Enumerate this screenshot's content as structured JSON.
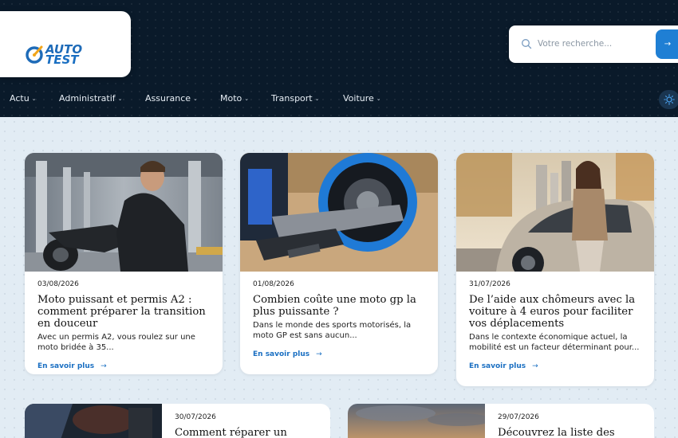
{
  "logo": {
    "line1": "AUTO",
    "line2": "TEST"
  },
  "search": {
    "placeholder": "Votre recherche...",
    "button_label": "→"
  },
  "nav": {
    "items": [
      {
        "label": "Actu"
      },
      {
        "label": "Administratif"
      },
      {
        "label": "Assurance"
      },
      {
        "label": "Moto"
      },
      {
        "label": "Transport"
      },
      {
        "label": "Voiture"
      }
    ],
    "chevron": "⌄"
  },
  "read_more": "En savoir plus",
  "read_more_arrow": "→",
  "articles": [
    {
      "date": "03/08/2026",
      "title": "Moto puissant et permis A2 : comment préparer la transition en douceur",
      "excerpt": "Avec un permis A2, vous roulez sur une moto bridée à 35..."
    },
    {
      "date": "01/08/2026",
      "title": "Combien coûte une moto gp la plus puissante ?",
      "excerpt": "Dans le monde des sports motorisés, la moto GP est sans aucun..."
    },
    {
      "date": "31/07/2026",
      "title": "De l’aide aux chômeurs avec la voiture à 4 euros pour faciliter vos déplacements",
      "excerpt": "Dans le contexte économique actuel, la mobilité est un facteur déterminant pour..."
    },
    {
      "date": "30/07/2026",
      "title": "Comment réparer un système de"
    },
    {
      "date": "29/07/2026",
      "title": "Découvrez la liste des marques"
    }
  ],
  "colors": {
    "accent": "#1f7fd4",
    "header_bg": "#0a1a2a",
    "page_bg": "#e2ecf4"
  }
}
